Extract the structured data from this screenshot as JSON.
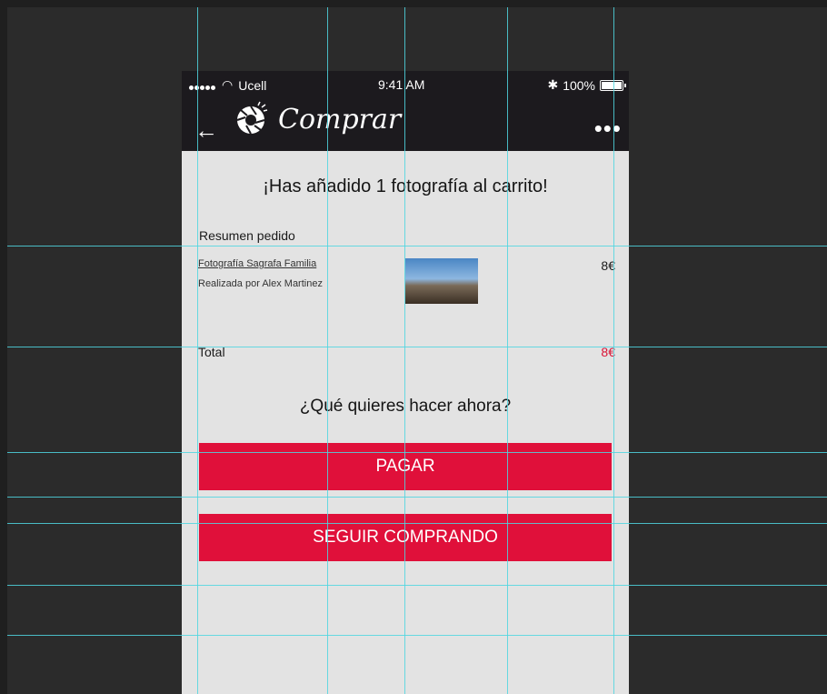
{
  "status_bar": {
    "carrier": "Ucell",
    "time": "9:41 AM",
    "battery": "100%"
  },
  "header": {
    "title": "Comprar",
    "back_icon": "back-arrow-icon",
    "logo_icon": "camera-shutter-logo-icon",
    "more_icon": "more-dots-icon"
  },
  "cart": {
    "headline": "¡Has añadido 1 fotografía al carrito!",
    "summary_title": "Resumen pedido",
    "item": {
      "name": "Fotografía Sagrafa Familia",
      "author": "Realizada por Alex Martinez",
      "price": "8€"
    },
    "total_label": "Total",
    "total_price": "8€"
  },
  "next_step": {
    "question": "¿Qué quieres hacer ahora?",
    "pay_label": "PAGAR",
    "continue_label": "SEGUIR COMPRANDO"
  },
  "colors": {
    "accent": "#e0103a",
    "appbar": "#1c1a1e",
    "background": "#e3e3e3",
    "guides": "#4fd6e0"
  }
}
